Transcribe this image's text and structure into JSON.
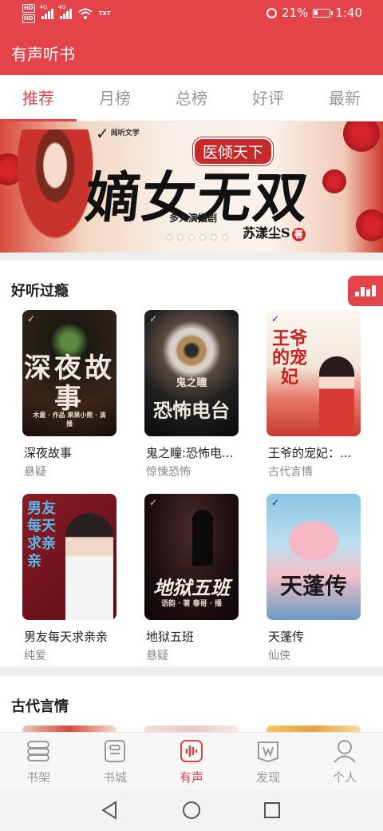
{
  "status_bar": {
    "hd1": "HD",
    "hd2": "HD",
    "network1": "4G",
    "network2": "4G",
    "txt": "TXT",
    "battery_percent": "21%",
    "battery_level": 0.21,
    "time": "1:40",
    "icons": [
      "wifi-icon",
      "alarm-icon",
      "battery-icon"
    ]
  },
  "header": {
    "title": "有声听书"
  },
  "tabs": [
    {
      "label": "推荐",
      "active": true
    },
    {
      "label": "月榜",
      "active": false
    },
    {
      "label": "总榜",
      "active": false
    },
    {
      "label": "好评",
      "active": false
    },
    {
      "label": "最新",
      "active": false
    }
  ],
  "banner": {
    "logo_text": "阅听文学",
    "tag": "医倾天下",
    "title": "嫡女无双",
    "subtitle": "多人演播剧",
    "author": "苏漾尘S",
    "author_suffix": "著",
    "dot_count": 6,
    "active_dot": 0
  },
  "sections": [
    {
      "title": "好听过瘾",
      "books": [
        {
          "title": "深夜故事",
          "category": "悬疑",
          "cover_text": "深夜故事",
          "cover_sub": "木童 · 作品  果果小熊 · 演播",
          "cover_color": "#2a1a14"
        },
        {
          "title": "鬼之瞳:恐怖电...",
          "category": "惊悚恐怖",
          "cover_text": "恐怖电台",
          "cover_sub": "鬼之瞳",
          "cover_color": "#1c1c1c"
        },
        {
          "title": "王爷的宠妃：...",
          "category": "古代言情",
          "cover_text": "王爷的宠妃",
          "cover_sub": "",
          "cover_color": "#f4efe6"
        },
        {
          "title": "男友每天求亲亲",
          "category": "纯爱",
          "cover_text": "男友每天求亲亲",
          "cover_sub": "",
          "cover_color": "#6a1a24"
        },
        {
          "title": "地狱五班",
          "category": "悬疑",
          "cover_text": "地狱五班",
          "cover_sub": "语韵 · 著  春哥 · 播",
          "cover_color": "#2a1216"
        },
        {
          "title": "天蓬传",
          "category": "仙侠",
          "cover_text": "天蓬传",
          "cover_sub": "",
          "cover_color": "#7fb8d8"
        }
      ]
    },
    {
      "title": "古代言情"
    }
  ],
  "bottom_nav": [
    {
      "label": "书架",
      "icon": "bookshelf-icon",
      "active": false
    },
    {
      "label": "书城",
      "icon": "bookstore-icon",
      "active": false
    },
    {
      "label": "有声",
      "icon": "audio-icon",
      "active": true
    },
    {
      "label": "发现",
      "icon": "discover-icon",
      "active": false
    },
    {
      "label": "个人",
      "icon": "profile-icon",
      "active": false
    }
  ],
  "system_nav": [
    "back-icon",
    "home-icon",
    "recents-icon"
  ],
  "colors": {
    "accent": "#e4434a",
    "inactive": "#999999",
    "background": "#eeeeee"
  }
}
